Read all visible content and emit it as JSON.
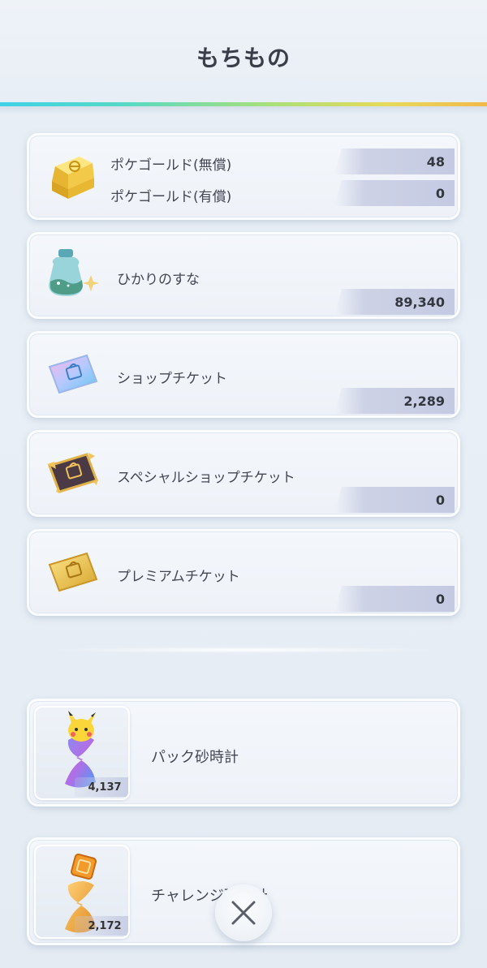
{
  "header": {
    "title": "もちもの"
  },
  "items": [
    {
      "icon": "gold-bar-icon",
      "labels": [
        "ポケゴールド(無償)",
        "ポケゴールド(有償)"
      ],
      "values": [
        "48",
        "0"
      ]
    },
    {
      "icon": "sand-bottle-icon",
      "label": "ひかりのすな",
      "value": "89,340"
    },
    {
      "icon": "shop-ticket-icon",
      "label": "ショップチケット",
      "value": "2,289"
    },
    {
      "icon": "special-shop-ticket-icon",
      "label": "スペシャルショップチケット",
      "value": "0"
    },
    {
      "icon": "premium-ticket-icon",
      "label": "プレミアムチケット",
      "value": "0"
    }
  ],
  "hourglasses": [
    {
      "icon": "pack-hourglass-icon",
      "label": "パック砂時計",
      "count": "4,137"
    },
    {
      "icon": "challenge-hourglass-icon",
      "label": "チャレンジ砂時計",
      "count": "2,172"
    }
  ],
  "close_button": {
    "icon": "close-icon"
  }
}
